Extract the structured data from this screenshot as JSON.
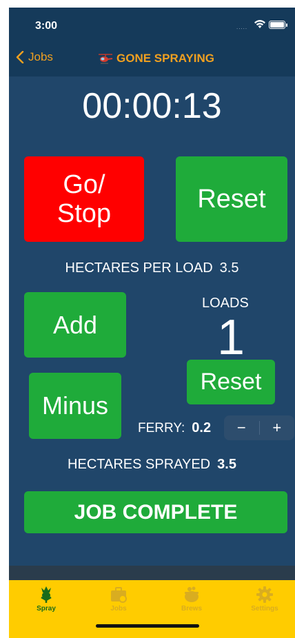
{
  "status": {
    "time": "3:00",
    "signal": "....."
  },
  "nav": {
    "back_label": "Jobs",
    "title": "GONE SPRAYING",
    "icon": "helicopter-icon"
  },
  "timer": {
    "value": "00:00:13"
  },
  "controls": {
    "gostop_line1": "Go/",
    "gostop_line2": "Stop",
    "reset_label": "Reset",
    "hectares_per_load_label": "HECTARES PER LOAD",
    "hectares_per_load_value": "3.5",
    "add_label": "Add",
    "minus_label": "Minus",
    "loads_label": "LOADS",
    "loads_value": "1",
    "loads_reset_label": "Reset",
    "ferry_label": "FERRY:",
    "ferry_value": "0.2",
    "stepper_minus": "−",
    "stepper_plus": "+",
    "hectares_sprayed_label": "HECTARES SPRAYED",
    "hectares_sprayed_value": "3.5",
    "job_complete_label": "JOB COMPLETE"
  },
  "tabs": [
    {
      "label": "Spray",
      "icon": "thistle-icon",
      "active": true
    },
    {
      "label": "Jobs",
      "icon": "briefcase-icon",
      "active": false
    },
    {
      "label": "Brews",
      "icon": "cauldron-icon",
      "active": false
    },
    {
      "label": "Settings",
      "icon": "gear-icon",
      "active": false
    }
  ],
  "colors": {
    "background": "#20466a",
    "navbar": "#153a5a",
    "accent_orange": "#f0a020",
    "green_button": "#1fab3a",
    "red_button": "#ff0000",
    "tabbar": "#ffcc00"
  }
}
